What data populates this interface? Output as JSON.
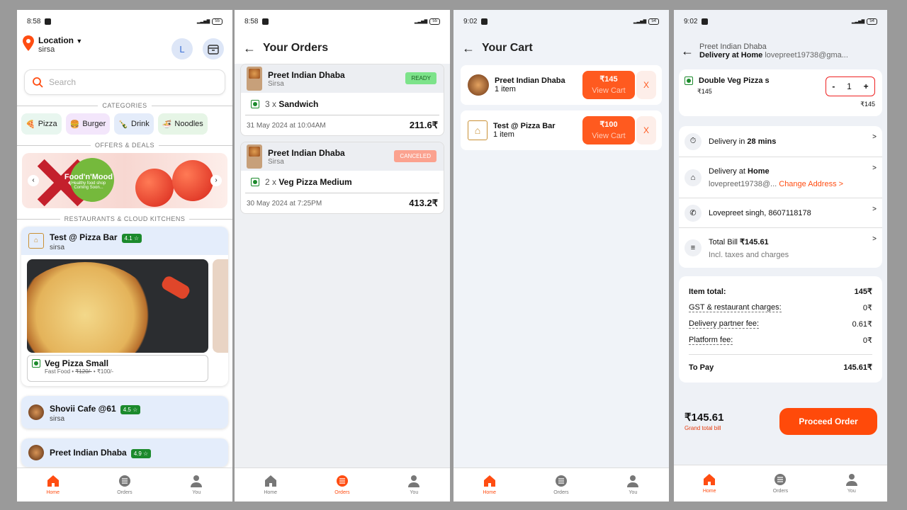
{
  "s1": {
    "time": "8:58",
    "battery": "55",
    "location_label": "Location",
    "location_city": "sirsa",
    "avatar_letter": "L",
    "search_placeholder": "Search",
    "categories_title": "CATEGORIES",
    "categories": [
      {
        "label": "Pizza",
        "icon": "pizza-icon",
        "bg": "#e8f6ef"
      },
      {
        "label": "Burger",
        "icon": "burger-icon",
        "bg": "#f3e6fb"
      },
      {
        "label": "Drink",
        "icon": "drink-icon",
        "bg": "#e4ecfa"
      },
      {
        "label": "Noodles",
        "icon": "noodles-icon",
        "bg": "#e6f5e6"
      }
    ],
    "offers_title": "OFFERS & DEALS",
    "banner_brand": "Food'n'Mood",
    "banner_sub1": "Healthy food shop",
    "banner_sub2": "Coming Soon...",
    "restaurants_title": "RESTAURANTS & CLOUD KITCHENS",
    "restaurants": [
      {
        "name": "Test @ Pizza Bar",
        "rating": "4.1 ☆",
        "city": "sirsa"
      },
      {
        "name": "Shovii Cafe @61",
        "rating": "4.5 ☆",
        "city": "sirsa"
      },
      {
        "name": "Preet Indian Dhaba",
        "rating": "4.9 ☆",
        "city": ""
      }
    ],
    "dish_name": "Veg Pizza Small",
    "dish_meta_prefix": "Fast Food • ",
    "dish_old_price": "₹120/-",
    "dish_new_price": " • ₹100/-",
    "nav": {
      "home": "Home",
      "orders": "Orders",
      "you": "You"
    }
  },
  "s2": {
    "time": "8:58",
    "battery": "55",
    "title": "Your Orders",
    "orders": [
      {
        "restaurant": "Preet Indian Dhaba",
        "city": "Sirsa",
        "status": "READY",
        "qty": "3 x ",
        "item": "Sandwich",
        "date": "31 May 2024 at 10:04AM",
        "total": "211.6₹"
      },
      {
        "restaurant": "Preet Indian Dhaba",
        "city": "Sirsa",
        "status": "CANCELED",
        "qty": "2 x ",
        "item": "Veg Pizza Medium",
        "date": "30 May 2024 at 7:25PM",
        "total": "413.2₹"
      }
    ],
    "nav": {
      "home": "Home",
      "orders": "Orders",
      "you": "You"
    }
  },
  "s3": {
    "time": "9:02",
    "battery": "54",
    "title": "Your Cart",
    "carts": [
      {
        "restaurant": "Preet Indian Dhaba",
        "items": "1 item",
        "price": "₹145",
        "cta": "View Cart",
        "remove": "X"
      },
      {
        "restaurant": "Test @ Pizza Bar",
        "items": "1 item",
        "price": "₹100",
        "cta": "View Cart",
        "remove": "X"
      }
    ],
    "nav": {
      "home": "Home",
      "orders": "Orders",
      "you": "You"
    }
  },
  "s4": {
    "time": "9:02",
    "battery": "54",
    "restaurant": "Preet Indian Dhaba",
    "delivery_at_prefix": "Delivery at ",
    "delivery_at_place": "Home",
    "email_short": "lovepreet19738@gma...",
    "item_name": "Double Veg Pizza s",
    "item_price": "₹145",
    "item_qty": "1",
    "minus": "-",
    "plus": "+",
    "item_total_right": "₹145",
    "delivery_in_prefix": "Delivery in ",
    "delivery_in_time": "28 mins",
    "address_title_prefix": "Delivery at ",
    "address_title_place": "Home",
    "address_email": "lovepreet19738@...",
    "change_address": "Change Address >",
    "contact": "Lovepreet singh, 8607118178",
    "total_bill_prefix": "Total Bill ",
    "total_bill_value": "₹145.61",
    "total_bill_sub": "Incl. taxes and charges",
    "bill": [
      {
        "label": "Item total:",
        "value": "145₹"
      },
      {
        "label": "GST & restaurant charges:",
        "value": "0₹"
      },
      {
        "label": "Delivery partner fee:",
        "value": "0.61₹"
      },
      {
        "label": "Platform fee:",
        "value": "0₹"
      }
    ],
    "to_pay_label": "To Pay",
    "to_pay_value": "145.61₹",
    "grand_total": "₹145.61",
    "grand_total_label": "Grand total bill",
    "proceed": "Proceed Order",
    "nav": {
      "home": "Home",
      "orders": "Orders",
      "you": "You"
    }
  },
  "colors": {
    "accent": "#ff4d12",
    "ready": "#7de38a",
    "canceled": "#fba28f",
    "veg": "#1c8a2c"
  }
}
